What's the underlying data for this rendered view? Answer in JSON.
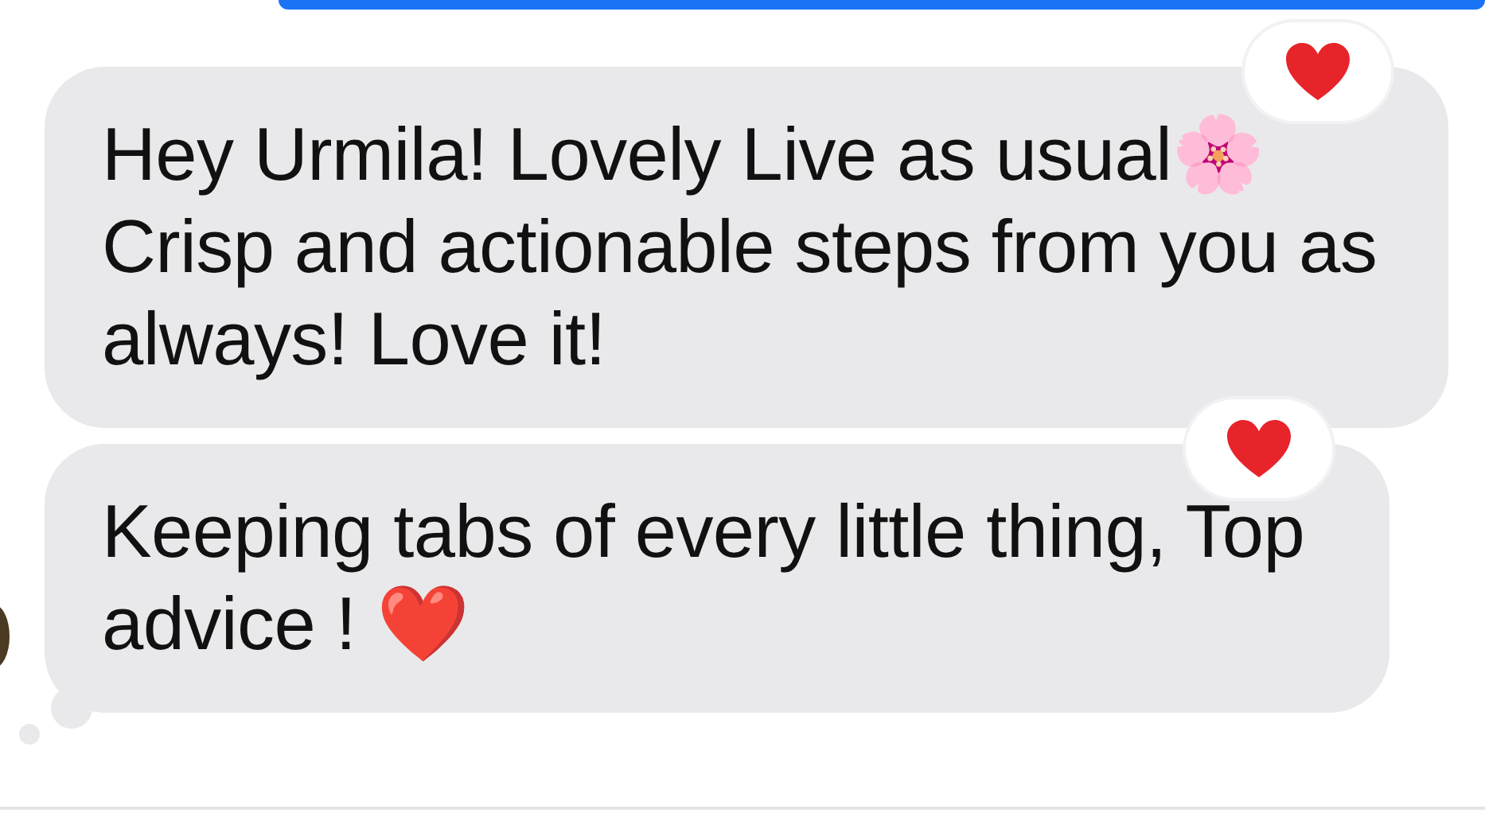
{
  "messages": [
    {
      "text": "Hey Urmila! Lovely Live as usual🌸 Crisp and actionable steps from you as always! Love it!",
      "reacted": true,
      "tail": false
    },
    {
      "text": "Keeping tabs of every little thing, Top advice ! ❤️",
      "reacted": true,
      "tail": true
    }
  ]
}
